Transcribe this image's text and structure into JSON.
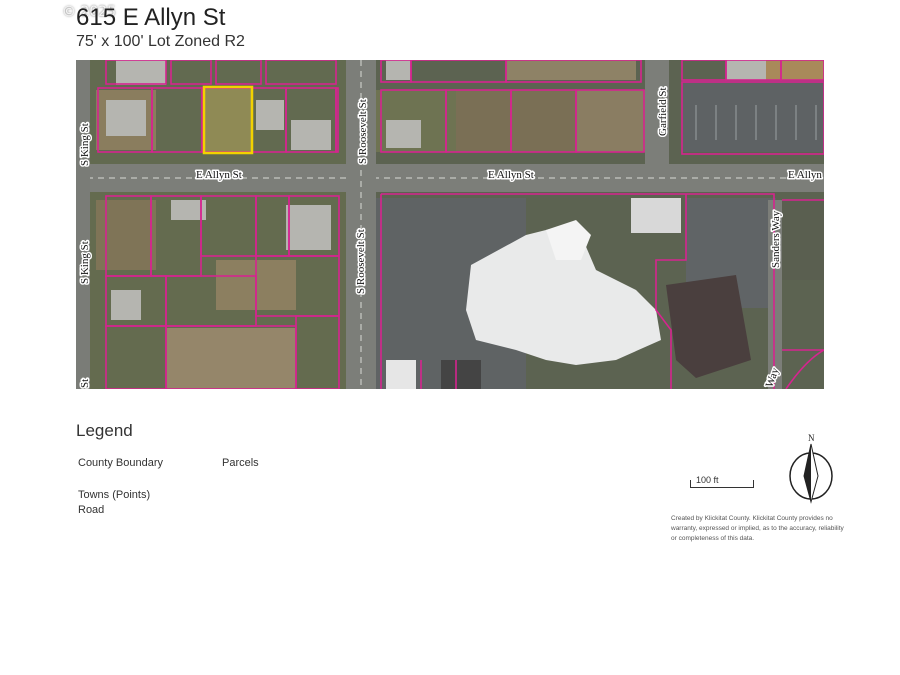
{
  "watermark": "© 2025",
  "title": "615 E Allyn St",
  "subtitle": "75' x 100' Lot Zoned R2",
  "map": {
    "streets": {
      "king_top": "S King St",
      "king_mid": "S King St",
      "king_bottom": "St",
      "roosevelt_top": "S Roosevelt St",
      "roosevelt_bottom": "S Roosevelt St",
      "garfield": "Garfield St",
      "allyn_left": "E Allyn St",
      "allyn_mid": "E Allyn St",
      "allyn_right": "E Allyn",
      "sanders": "Sanders Way",
      "sanders_bottom": "Way"
    },
    "colors": {
      "parcel_line": "#d6248f",
      "highlight_parcel": "#f2d200"
    }
  },
  "legend": {
    "title": "Legend",
    "items": {
      "county_boundary": "County Boundary",
      "parcels": "Parcels",
      "towns": "Towns (Points)",
      "road": "Road"
    }
  },
  "scale_bar": {
    "label": "100 ft"
  },
  "north_arrow": {
    "label": "N"
  },
  "disclaimer": "Created by Klickitat County. Klickitat County provides no warranty, expressed or implied, as to the accuracy, reliability or completeness of this data."
}
